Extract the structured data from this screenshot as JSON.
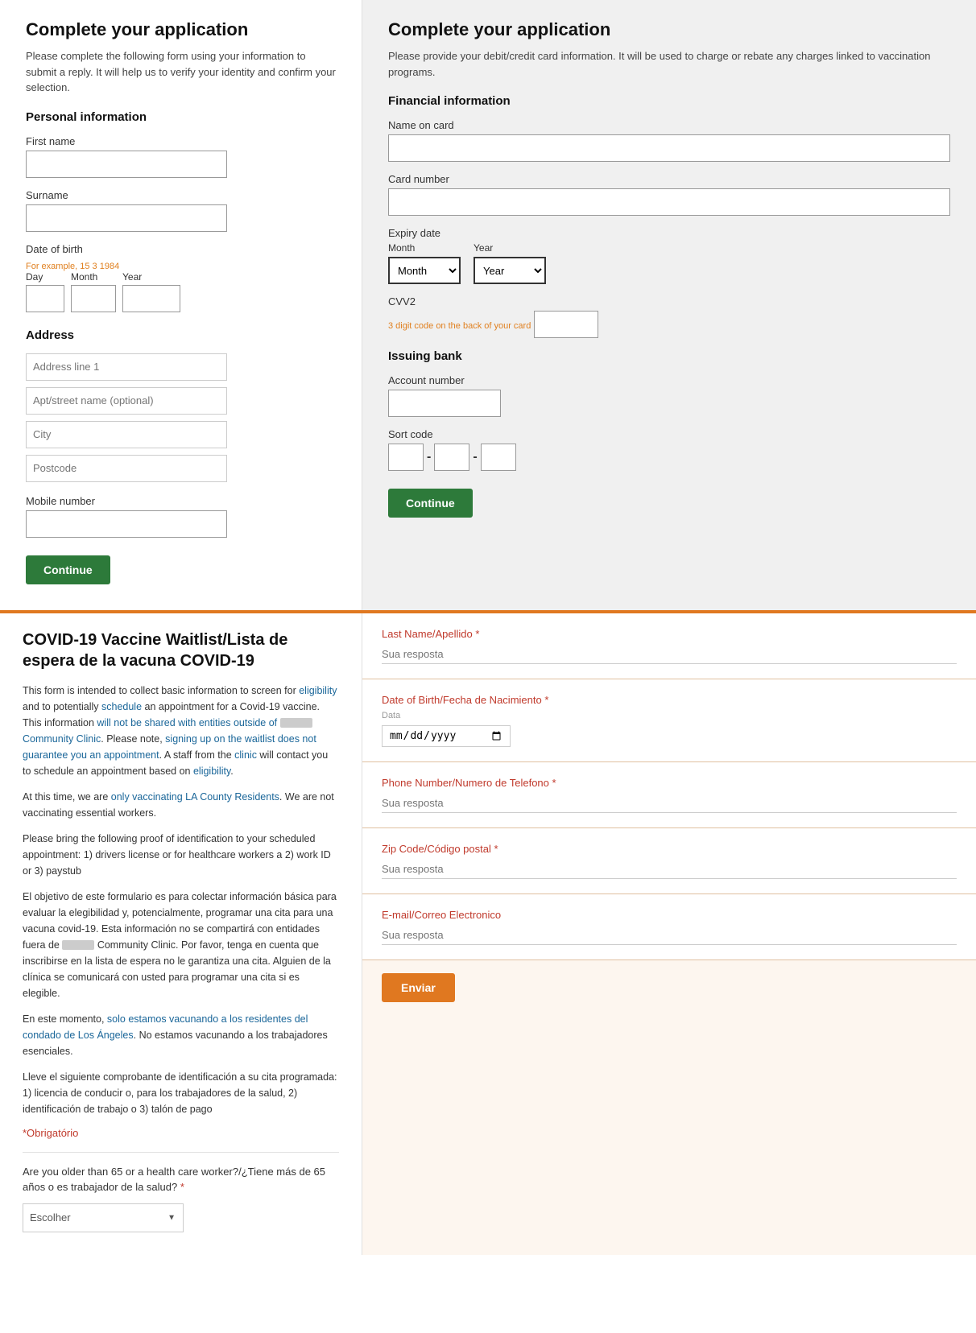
{
  "left": {
    "title": "Complete your application",
    "subtitle": "Please complete the following form using your information to submit a reply. It will help us to verify your identity and confirm your selection.",
    "personal_section": "Personal information",
    "first_name_label": "First name",
    "surname_label": "Surname",
    "dob_label": "Date of birth",
    "dob_hint": "For example, 15 3 1984",
    "dob_day_label": "Day",
    "dob_month_label": "Month",
    "dob_year_label": "Year",
    "address_section": "Address",
    "address_line1_placeholder": "Address line 1",
    "address_line2_placeholder": "Apt/street name (optional)",
    "city_placeholder": "City",
    "postcode_placeholder": "Postcode",
    "mobile_label": "Mobile number",
    "continue_label": "Continue"
  },
  "right": {
    "title": "Complete your application",
    "subtitle": "Please provide your debit/credit card information. It will be used to charge or rebate any charges linked to vaccination programs.",
    "financial_section": "Financial information",
    "name_on_card_label": "Name on card",
    "card_number_label": "Card number",
    "expiry_date_label": "Expiry date",
    "month_label": "Month",
    "year_label": "Year",
    "month_placeholder": "Month",
    "year_placeholder": "Year",
    "cvv2_label": "CVV2",
    "cvv2_hint": "3 digit code on the back of your card",
    "issuing_bank_section": "Issuing bank",
    "account_number_label": "Account number",
    "sort_code_label": "Sort code",
    "continue_label": "Continue"
  },
  "bottom_left": {
    "title": "COVID-19 Vaccine Waitlist/Lista de espera de la vacuna COVID-19",
    "para1": "This form is intended to collect basic information to screen for eligibility and to potentially schedule an appointment for a Covid-19 vaccine. This information will not be shared with entities outside of",
    "para1b": "Community Clinic. Please note, signing up on the waitlist does not guarantee you an appointment. A staff from the clinic will contact you to schedule an appointment based on eligibility.",
    "para2": "At this time, we are only vaccinating LA County Residents. We are not vaccinating essential workers.",
    "para3": "Please bring the following proof of identification to your scheduled appointment: 1) drivers license or for healthcare workers a 2) work ID or 3) paystub",
    "para4_es": "El objetivo de este formulario es para colectar información básica para evaluar la elegibilidad y, potencialmente, programar una cita para una vacuna covid-19. Esta información no se compartirá con entidades fuera de",
    "para4b_es": "Community Clinic. Por favor, tenga en cuenta que inscribirse en la lista de espera no le garantiza una cita. Alguien de la clínica se comunicará con usted para programar una cita si es elegible.",
    "para5_es": "En este momento, solo estamos vacunando a los residentes del condado de Los Ángeles. No estamos vacunando a los trabajadores esenciales.",
    "para6_es": "Lleve el siguiente comprobante de identificación a su cita programada: 1) licencia de conducir o, para los trabajadores de la salud, 2) identificación de trabajo o 3) talón de pago",
    "obrigatorio": "*Obrigatório",
    "question": "Are you older than 65 or a health care worker?/¿Tiene más de 65 años o es trabajador de la salud?",
    "required_star": "*",
    "escolher_placeholder": "Escolher"
  },
  "bottom_right": {
    "last_name_label": "Last Name/Apellido",
    "required_star": "*",
    "last_name_placeholder": "Sua resposta",
    "dob_label": "Date of Birth/Fecha de Nacimiento",
    "dob_sublabel": "Data",
    "dob_placeholder": "mm/dd/yyyy",
    "phone_label": "Phone Number/Numero de Telefono",
    "phone_placeholder": "Sua resposta",
    "zip_label": "Zip Code/Código postal",
    "zip_placeholder": "Sua resposta",
    "email_label": "E-mail/Correo Electronico",
    "email_placeholder": "Sua resposta",
    "enviar_label": "Enviar"
  }
}
